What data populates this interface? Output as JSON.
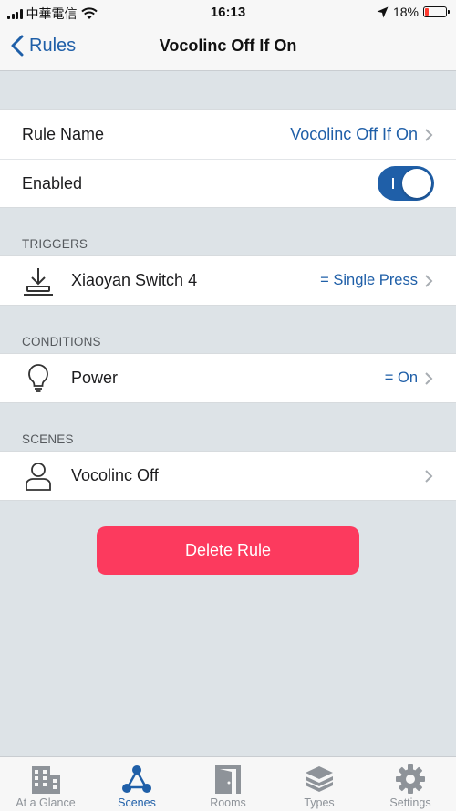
{
  "status_bar": {
    "carrier": "中華電信",
    "time": "16:13",
    "battery": "18%",
    "battery_level": 0.18,
    "icons": [
      "signal-icon",
      "wifi-icon",
      "location-arrow-icon",
      "battery-icon"
    ]
  },
  "nav": {
    "back_label": "Rules",
    "title": "Vocolinc Off If On"
  },
  "rule": {
    "name_label": "Rule Name",
    "name_value": "Vocolinc Off If On",
    "enabled_label": "Enabled",
    "enabled": true
  },
  "triggers": {
    "header": "TRIGGERS",
    "items": [
      {
        "icon": "download-tray-icon",
        "label": "Xiaoyan Switch 4",
        "value": "= Single Press"
      }
    ]
  },
  "conditions": {
    "header": "CONDITIONS",
    "items": [
      {
        "icon": "lightbulb-icon",
        "label": "Power",
        "value": "= On"
      }
    ]
  },
  "scenes": {
    "header": "SCENES",
    "items": [
      {
        "icon": "person-icon",
        "label": "Vocolinc Off",
        "value": ""
      }
    ]
  },
  "delete_label": "Delete Rule",
  "tabs": [
    {
      "label": "At a Glance",
      "icon": "building-icon",
      "active": false
    },
    {
      "label": "Scenes",
      "icon": "network-icon",
      "active": true
    },
    {
      "label": "Rooms",
      "icon": "door-icon",
      "active": false
    },
    {
      "label": "Types",
      "icon": "layers-icon",
      "active": false
    },
    {
      "label": "Settings",
      "icon": "gear-icon",
      "active": false
    }
  ],
  "colors": {
    "accent": "#1f5fa8",
    "delete": "#fc3a5e",
    "background": "#dde3e7"
  }
}
